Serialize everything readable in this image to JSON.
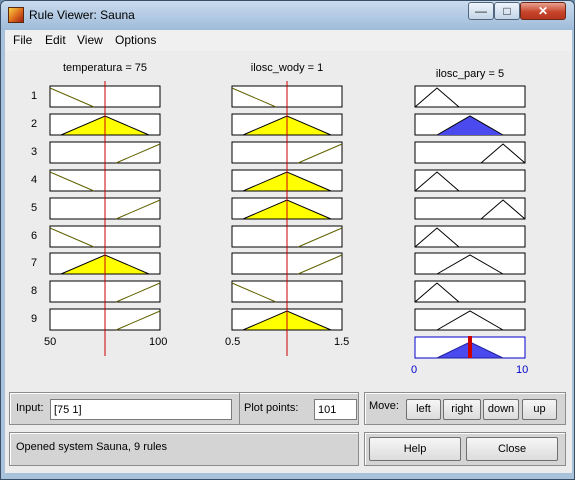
{
  "window": {
    "title": "Rule Viewer: Sauna",
    "controls": {
      "minimize": "—",
      "maximize": "□",
      "close": "✕"
    }
  },
  "menu": [
    "File",
    "Edit",
    "View",
    "Options"
  ],
  "variables": [
    {
      "title": "temperatura = 75",
      "range": [
        50,
        100
      ],
      "ticks": [
        "50",
        "100"
      ],
      "value": 75
    },
    {
      "title": "ilosc_wody = 1",
      "range": [
        0.5,
        1.5
      ],
      "ticks": [
        "0.5",
        "1.5"
      ],
      "value": 1
    },
    {
      "title": "ilosc_pary = 5",
      "range": [
        0,
        10
      ],
      "ticks": [
        "0",
        "10"
      ],
      "output": true,
      "value": 5
    }
  ],
  "rule_numbers": [
    "1",
    "2",
    "3",
    "4",
    "5",
    "6",
    "7",
    "8",
    "9"
  ],
  "rules": [
    {
      "temperatura": "low",
      "ilosc_wody": "low",
      "ilosc_pary": "low"
    },
    {
      "temperatura": "mid",
      "ilosc_wody": "mid",
      "ilosc_pary": "mid"
    },
    {
      "temperatura": "high",
      "ilosc_wody": "high",
      "ilosc_pary": "high"
    },
    {
      "temperatura": "low",
      "ilosc_wody": "mid",
      "ilosc_pary": "low"
    },
    {
      "temperatura": "high",
      "ilosc_wody": "mid",
      "ilosc_pary": "high"
    },
    {
      "temperatura": "low",
      "ilosc_wody": "high",
      "ilosc_pary": "low"
    },
    {
      "temperatura": "mid",
      "ilosc_wody": "high",
      "ilosc_pary": "mid"
    },
    {
      "temperatura": "high",
      "ilosc_wody": "low",
      "ilosc_pary": "low"
    },
    {
      "temperatura": "high",
      "ilosc_wody": "mid",
      "ilosc_pary": "mid"
    }
  ],
  "colors": {
    "input_fill": "#ffff00",
    "output_fill": "#4a4aef",
    "guide_line": "#cc0000",
    "mf_line": "#000000",
    "inactive_line": "#606000",
    "box_border": "#000000",
    "aggregate_border": "#0000cc"
  },
  "controls": {
    "input_label": "Input:",
    "input_value": "[75 1]",
    "plot_points_label": "Plot points:",
    "plot_points_value": "101",
    "move_label": "Move:",
    "move_buttons": [
      "left",
      "right",
      "down",
      "up"
    ],
    "help": "Help",
    "close": "Close"
  },
  "status": "Opened system Sauna, 9 rules"
}
